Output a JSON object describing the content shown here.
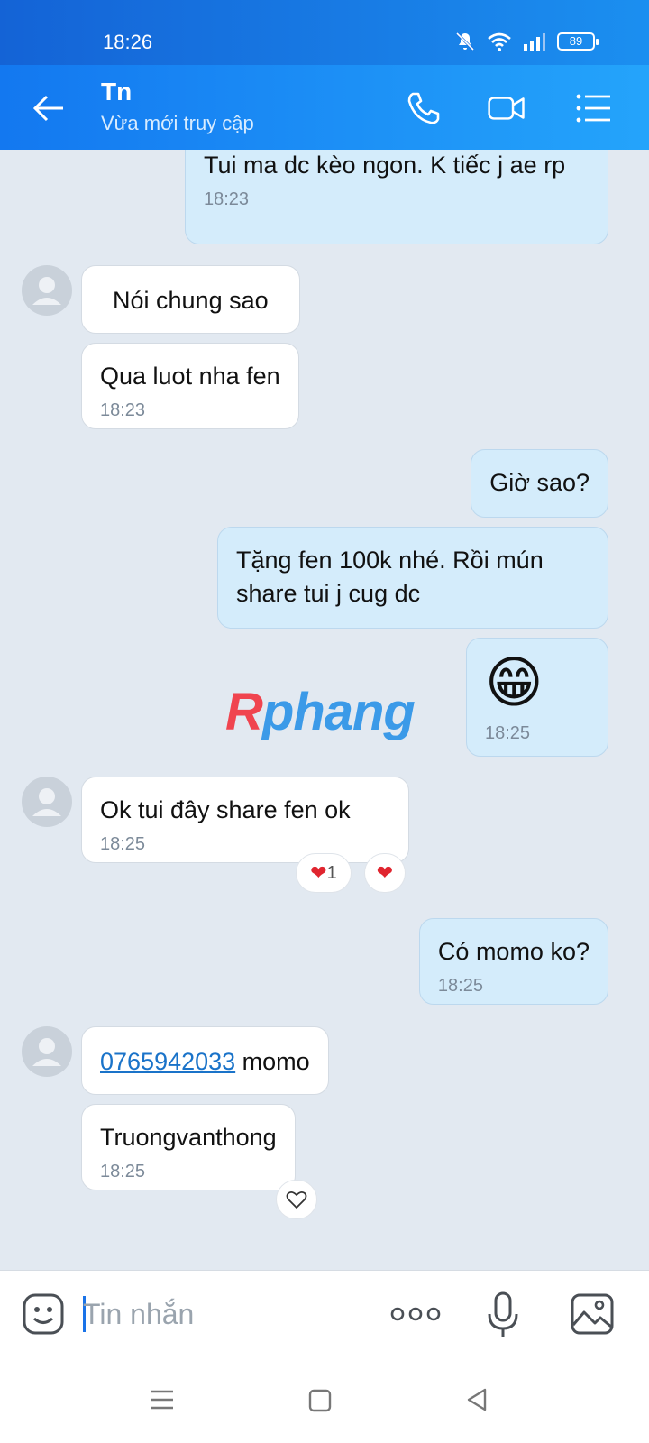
{
  "status_bar": {
    "time": "18:26",
    "battery": "89"
  },
  "header": {
    "contact_name": "Tn",
    "presence": "Vừa mới truy cập"
  },
  "messages": [
    {
      "text": "Tui ma dc kèo ngon. K tiếc j ae rp",
      "time": "18:23"
    },
    {
      "text": "Nói chung sao"
    },
    {
      "text": "Qua luot nha fen",
      "time": "18:23"
    },
    {
      "text": "Giờ sao?"
    },
    {
      "text": "Tặng fen 100k nhé. Rồi mún share tui j cug dc"
    },
    {
      "emoji": "😁",
      "time": "18:25"
    },
    {
      "text": "Ok tui đây share fen ok",
      "time": "18:25",
      "reaction_count": "1"
    },
    {
      "text": "Có momo ko?",
      "time": "18:25"
    },
    {
      "link": "0765942033",
      "text": " momo"
    },
    {
      "text": "Truongvanthong",
      "time": "18:25"
    }
  ],
  "watermark": {
    "part1": "R",
    "part2": "phang"
  },
  "composer": {
    "placeholder": "Tin nhắn"
  },
  "colors": {
    "header": "#1b8ff0",
    "outgoing_bubble": "#d4ecfb",
    "incoming_bubble": "#ffffff",
    "background": "#e2e9f1"
  }
}
